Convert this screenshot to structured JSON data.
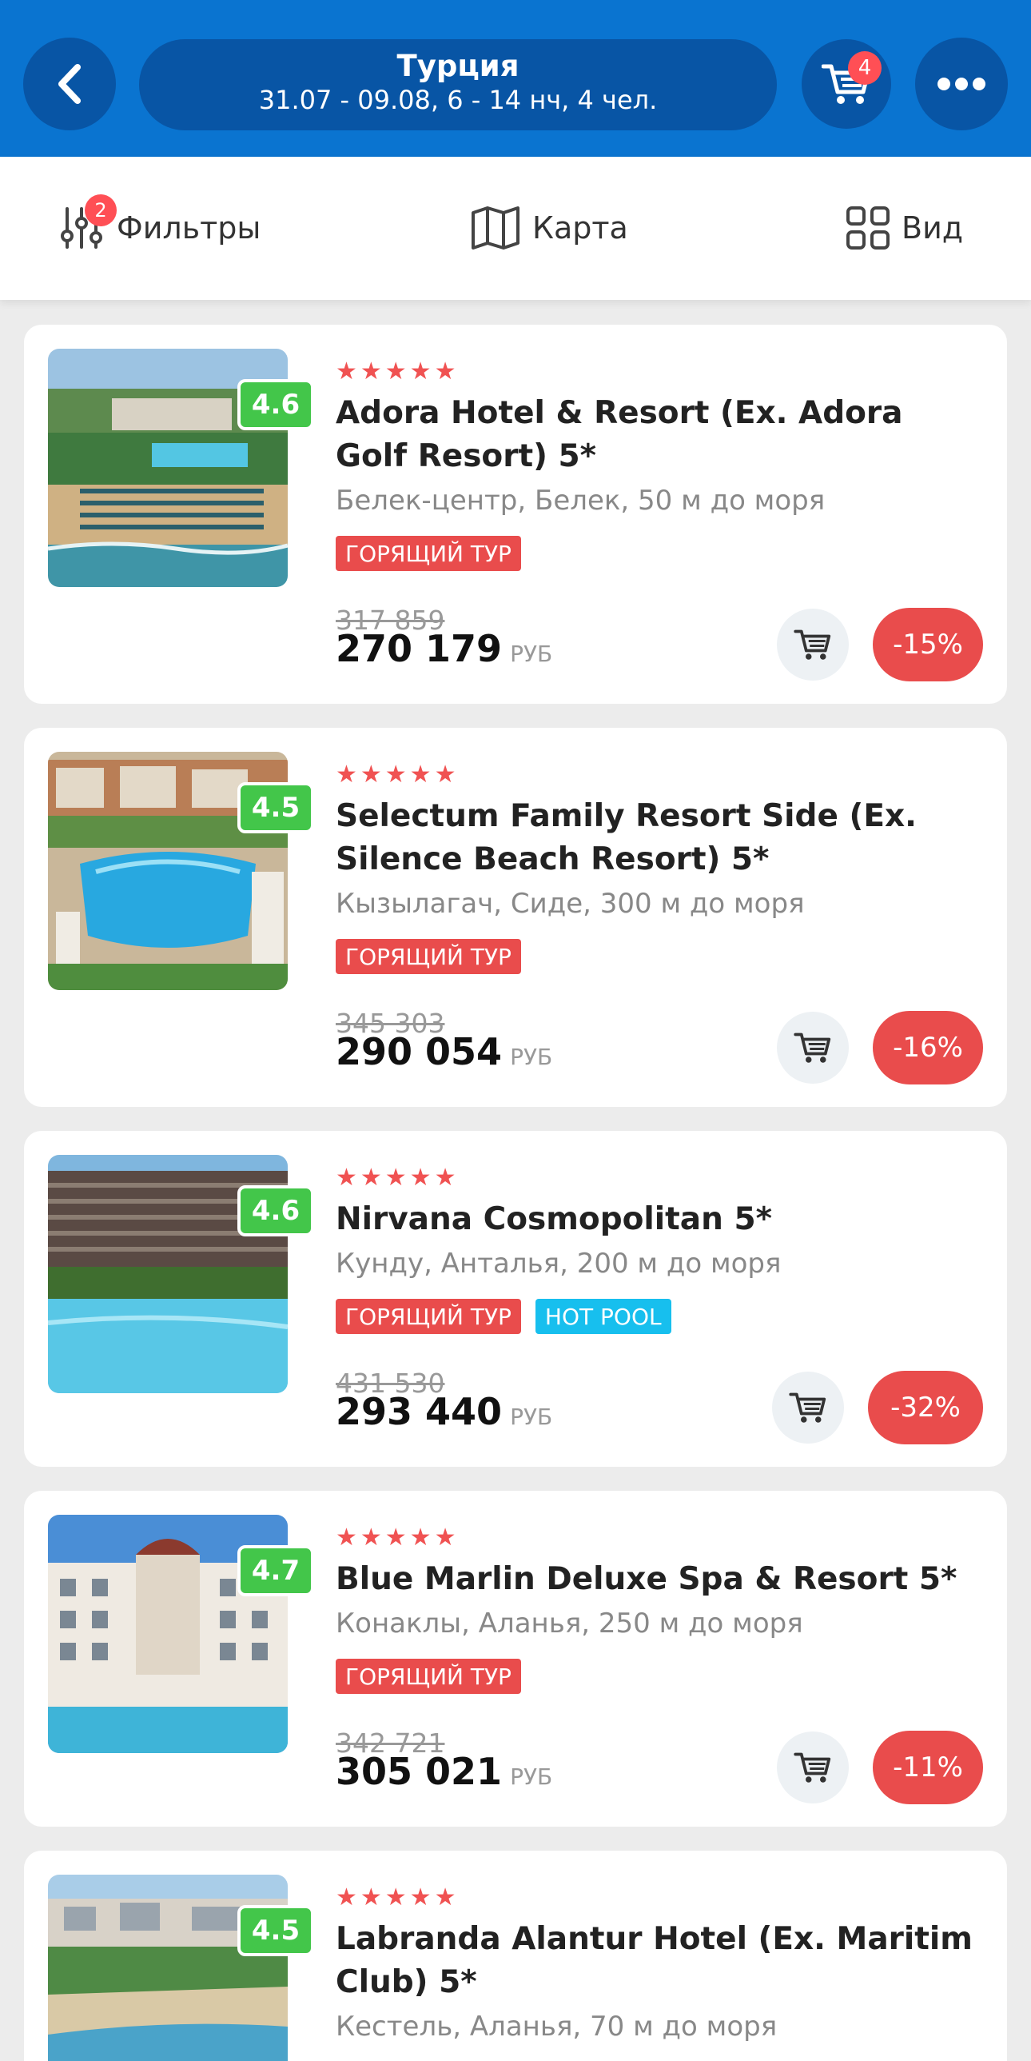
{
  "header": {
    "title": "Турция",
    "subtitle": "31.07 - 09.08, 6 - 14 нч, 4 чел.",
    "cart_count": "4"
  },
  "toolbar": {
    "filters_label": "Фильтры",
    "filters_badge": "2",
    "map_label": "Карта",
    "view_label": "Вид"
  },
  "hotels": [
    {
      "rating": "4.6",
      "name": "Adora Hotel & Resort (Ex. Adora Golf Resort) 5*",
      "location": "Белек-центр, Белек, 50 м до моря",
      "tags": [
        "ГОРЯЩИЙ ТУР"
      ],
      "old_price": "317 859",
      "price": "270 179",
      "currency": "РУБ",
      "discount": "-15%"
    },
    {
      "rating": "4.5",
      "name": "Selectum Family Resort Side (Ex. Silence Beach Resort) 5*",
      "location": "Кызылагач, Сиде, 300 м до моря",
      "tags": [
        "ГОРЯЩИЙ ТУР"
      ],
      "old_price": "345 303",
      "price": "290 054",
      "currency": "РУБ",
      "discount": "-16%"
    },
    {
      "rating": "4.6",
      "name": "Nirvana Cosmopolitan 5*",
      "location": "Кунду, Анталья, 200 м до моря",
      "tags": [
        "ГОРЯЩИЙ ТУР",
        "HOT POOL"
      ],
      "old_price": "431 530",
      "price": "293 440",
      "currency": "РУБ",
      "discount": "-32%"
    },
    {
      "rating": "4.7",
      "name": "Blue Marlin Deluxe Spa & Resort 5*",
      "location": "Конаклы, Аланья, 250 м до моря",
      "tags": [
        "ГОРЯЩИЙ ТУР"
      ],
      "old_price": "342 721",
      "price": "305 021",
      "currency": "РУБ",
      "discount": "-11%"
    },
    {
      "rating": "4.5",
      "name": "Labranda Alantur Hotel (Ex. Maritim Club) 5*",
      "location": "Кестель, Аланья, 70 м до моря",
      "stars": "★★★★★"
    }
  ],
  "stars": "★★★★★",
  "colors": {
    "header_bg": "#0a74d0",
    "pill_bg": "#0855a5",
    "rating_green": "#43c64a",
    "hot_tag": "#e94c4c",
    "pool_tag": "#17bfee",
    "badge_red": "#ff4f55"
  },
  "icons": [
    "back-arrow-icon",
    "cart-icon",
    "more-dots-icon",
    "filter-sliders-icon",
    "map-icon",
    "grid-view-icon"
  ]
}
